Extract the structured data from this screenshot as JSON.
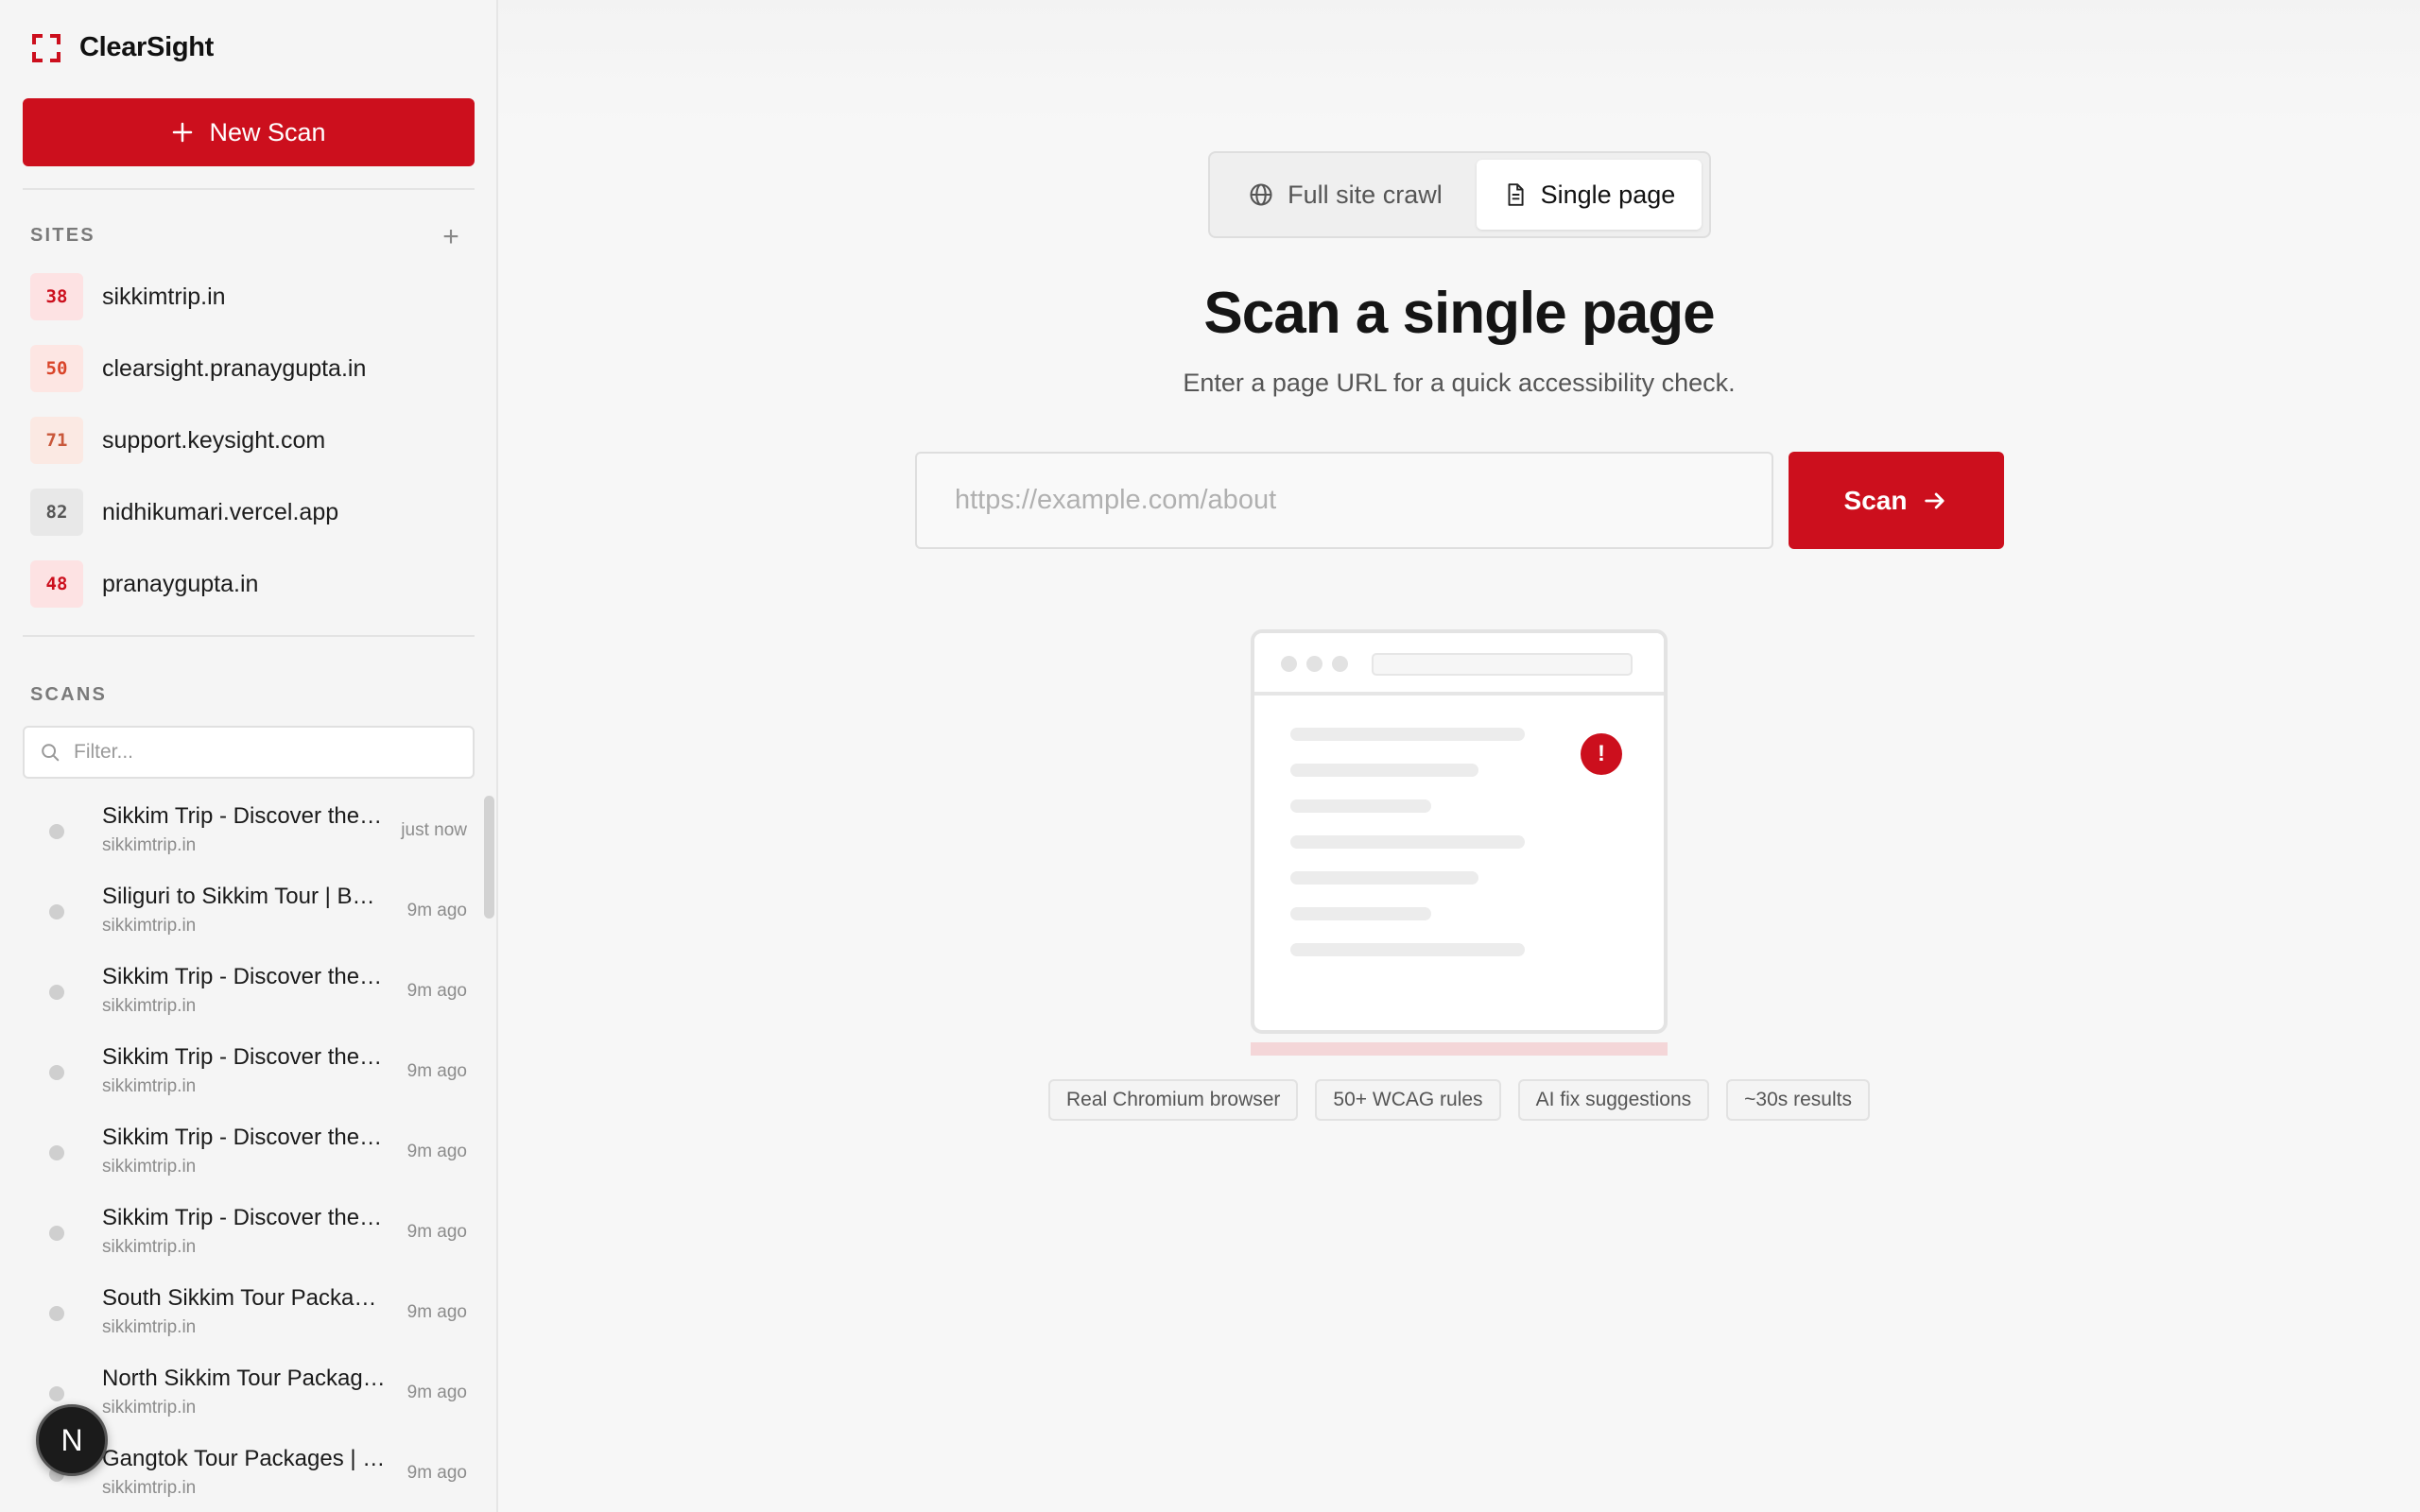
{
  "brand": {
    "name": "ClearSight",
    "accent": "#cc0f1d"
  },
  "sidebar": {
    "new_scan_label": "New Scan",
    "sites_label": "SITES",
    "add_site_glyph": "+",
    "sites": [
      {
        "score": "38",
        "name": "sikkimtrip.in",
        "bg": "#fde2e3",
        "fg": "#cc0f1d"
      },
      {
        "score": "50",
        "name": "clearsight.pranaygupta.in",
        "bg": "#fde6e3",
        "fg": "#d9452a"
      },
      {
        "score": "71",
        "name": "support.keysight.com",
        "bg": "#fbe9e3",
        "fg": "#c9583b"
      },
      {
        "score": "82",
        "name": "nidhikumari.vercel.app",
        "bg": "#e8e8e8",
        "fg": "#555555"
      },
      {
        "score": "48",
        "name": "pranaygupta.in",
        "bg": "#fde2e3",
        "fg": "#cc0f1d"
      }
    ],
    "scans_label": "SCANS",
    "filter_placeholder": "Filter...",
    "scans": [
      {
        "title": "Sikkim Trip - Discover the Beauty of Sikkim",
        "domain": "sikkimtrip.in",
        "time": "just now"
      },
      {
        "title": "Siliguri to Sikkim Tour | Best Packages",
        "domain": "sikkimtrip.in",
        "time": "9m ago"
      },
      {
        "title": "Sikkim Trip - Discover the Beauty of Sikkim",
        "domain": "sikkimtrip.in",
        "time": "9m ago"
      },
      {
        "title": "Sikkim Trip - Discover the Beauty of Sikkim",
        "domain": "sikkimtrip.in",
        "time": "9m ago"
      },
      {
        "title": "Sikkim Trip - Discover the Beauty of Sikkim",
        "domain": "sikkimtrip.in",
        "time": "9m ago"
      },
      {
        "title": "Sikkim Trip - Discover the Beauty of Sikkim",
        "domain": "sikkimtrip.in",
        "time": "9m ago"
      },
      {
        "title": "South Sikkim Tour Packages",
        "domain": "sikkimtrip.in",
        "time": "9m ago"
      },
      {
        "title": "North Sikkim Tour Packages",
        "domain": "sikkimtrip.in",
        "time": "9m ago"
      },
      {
        "title": "Gangtok Tour Packages | Sikkim",
        "domain": "sikkimtrip.in",
        "time": "9m ago"
      }
    ],
    "devtools_badge": "N"
  },
  "main": {
    "modes": {
      "full": "Full site crawl",
      "single": "Single page",
      "active": "single"
    },
    "heading": "Scan a single page",
    "subheading": "Enter a page URL for a quick accessibility check.",
    "url_placeholder": "https://example.com/about",
    "url_value": "",
    "scan_label": "Scan",
    "alert_glyph": "!",
    "features": [
      "Real Chromium browser",
      "50+ WCAG rules",
      "AI fix suggestions",
      "~30s results"
    ]
  }
}
